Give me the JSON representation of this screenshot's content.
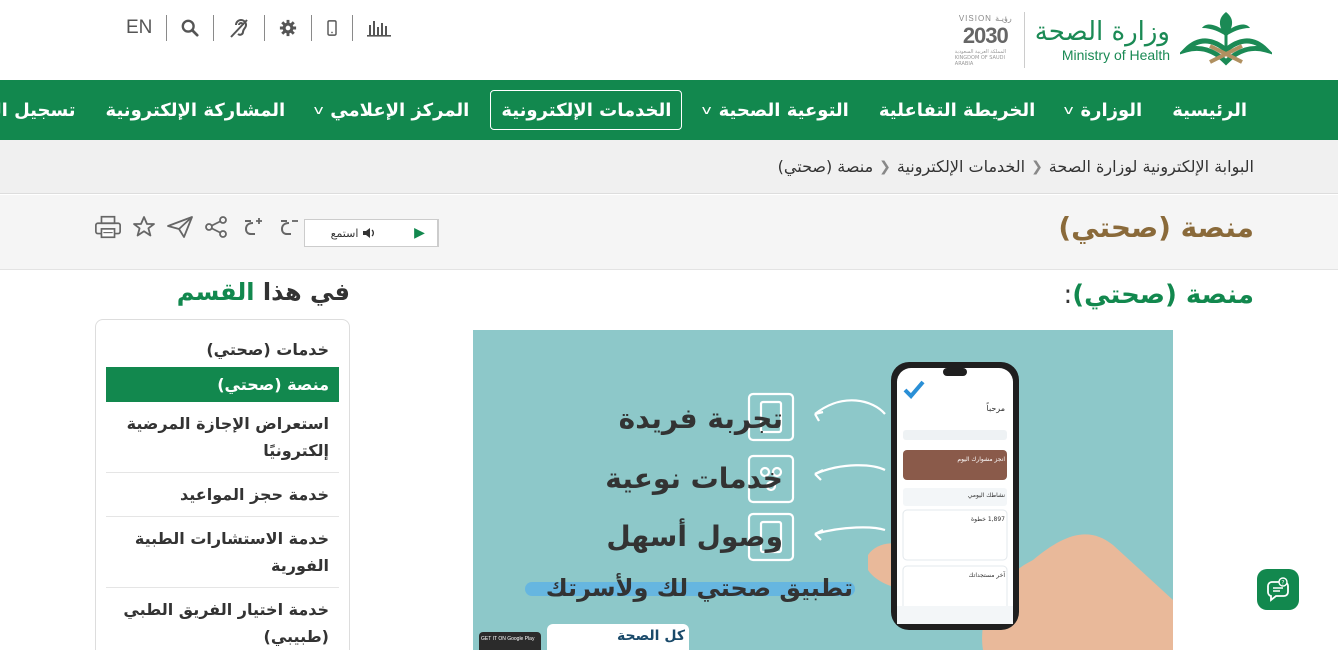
{
  "header": {
    "lang_toggle": "EN",
    "logo_ar": "وزارة الصحة",
    "logo_en": "Ministry of Health",
    "vision_line1": "VISION رؤيـة",
    "vision_year": "2030",
    "vision_sub": "المملكة العربية السعودية KINGDOM OF SAUDI ARABIA"
  },
  "nav": {
    "items": [
      {
        "label": "الرئيسية"
      },
      {
        "label": "الوزارة"
      },
      {
        "label": "الخريطة التفاعلية"
      },
      {
        "label": "التوعية الصحية"
      },
      {
        "label": "الخدمات الإلكترونية"
      },
      {
        "label": "المركز الإعلامي"
      },
      {
        "label": "المشاركة الإلكترونية"
      },
      {
        "label": "تسجيل الدخول"
      }
    ]
  },
  "breadcrumb": {
    "items": [
      "البوابة الإلكترونية لوزارة الصحة",
      "الخدمات الإلكترونية",
      "منصة (صحتي)"
    ]
  },
  "page": {
    "title": "منصة (صحتي)",
    "listen_label": "استمع",
    "content_title": "منصة (صحتي)",
    "content_colon": ":"
  },
  "banner": {
    "feature1": "تجربة فريدة",
    "feature2": "خدمات نوعية",
    "feature3": "وصول أسهل",
    "tagline": "تطبيق صحتي لك ولأسرتك",
    "bottom_text": "كل الصحة",
    "store_label": "GET IT ON Google Play",
    "phone_greeting": "مرحباً",
    "phone_card": "انجز مشوارك اليوم",
    "phone_activity": "نشاطك اليومي",
    "phone_steps": "1,897 خطوة",
    "phone_readings": "آخر مستجداتك"
  },
  "sidebar": {
    "title_a": "في هذا",
    "title_b": "القسم",
    "items": [
      {
        "label": "خدمات (صحتي)"
      },
      {
        "label": "منصة (صحتي)"
      },
      {
        "label": "استعراض الإجازة المرضية إلكترونيًا"
      },
      {
        "label": "خدمة حجز المواعيد"
      },
      {
        "label": "خدمة الاستشارات الطبية الفورية"
      },
      {
        "label": "خدمة اختيار الفريق الطبي (طبيبي)"
      }
    ]
  },
  "colors": {
    "brand_green": "#12884e",
    "title_brown": "#8a6a3a",
    "banner_bg": "#8dc8c9"
  }
}
